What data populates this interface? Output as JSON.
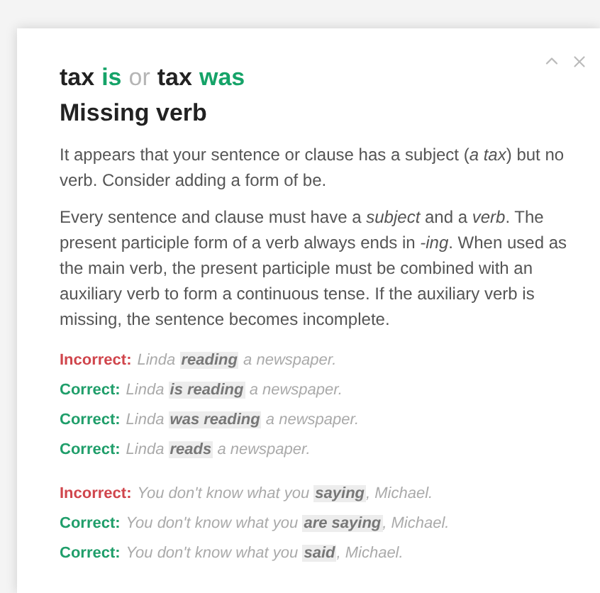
{
  "title": [
    {
      "kind": "plain",
      "text": "tax"
    },
    {
      "kind": "suggestion",
      "text": "is"
    },
    {
      "kind": "separator",
      "text": "or"
    },
    {
      "kind": "plain",
      "text": "tax"
    },
    {
      "kind": "suggestion",
      "text": "was"
    }
  ],
  "heading": "Missing verb",
  "paragraphs": [
    "It appears that your sentence or clause has a subject (*a tax*) but no verb. Consider adding a form of be.",
    "Every sentence and clause must have a *subject* and a *verb*. The present participle form of a verb always ends in *-ing*. When used as the main verb, the present participle must be combined with an auxiliary verb to form a continuous tense. If the auxiliary verb is missing, the sentence becomes incomplete."
  ],
  "example_groups": [
    [
      {
        "kind": "incorrect",
        "label": "Incorrect:",
        "before": "Linda",
        "highlight": "reading",
        "after": "a newspaper."
      },
      {
        "kind": "correct",
        "label": "Correct:",
        "before": "Linda",
        "highlight": "is reading",
        "after": "a newspaper."
      },
      {
        "kind": "correct",
        "label": "Correct:",
        "before": "Linda",
        "highlight": "was reading",
        "after": "a newspaper."
      },
      {
        "kind": "correct",
        "label": "Correct:",
        "before": "Linda",
        "highlight": "reads",
        "after": "a newspaper."
      }
    ],
    [
      {
        "kind": "incorrect",
        "label": "Incorrect:",
        "before": "You don't know what you",
        "highlight": "saying",
        "after": ", Michael."
      },
      {
        "kind": "correct",
        "label": "Correct:",
        "before": "You don't know what you",
        "highlight": "are saying",
        "after": ", Michael."
      },
      {
        "kind": "correct",
        "label": "Correct:",
        "before": "You don't know what you",
        "highlight": "said",
        "after": ", Michael."
      }
    ]
  ]
}
